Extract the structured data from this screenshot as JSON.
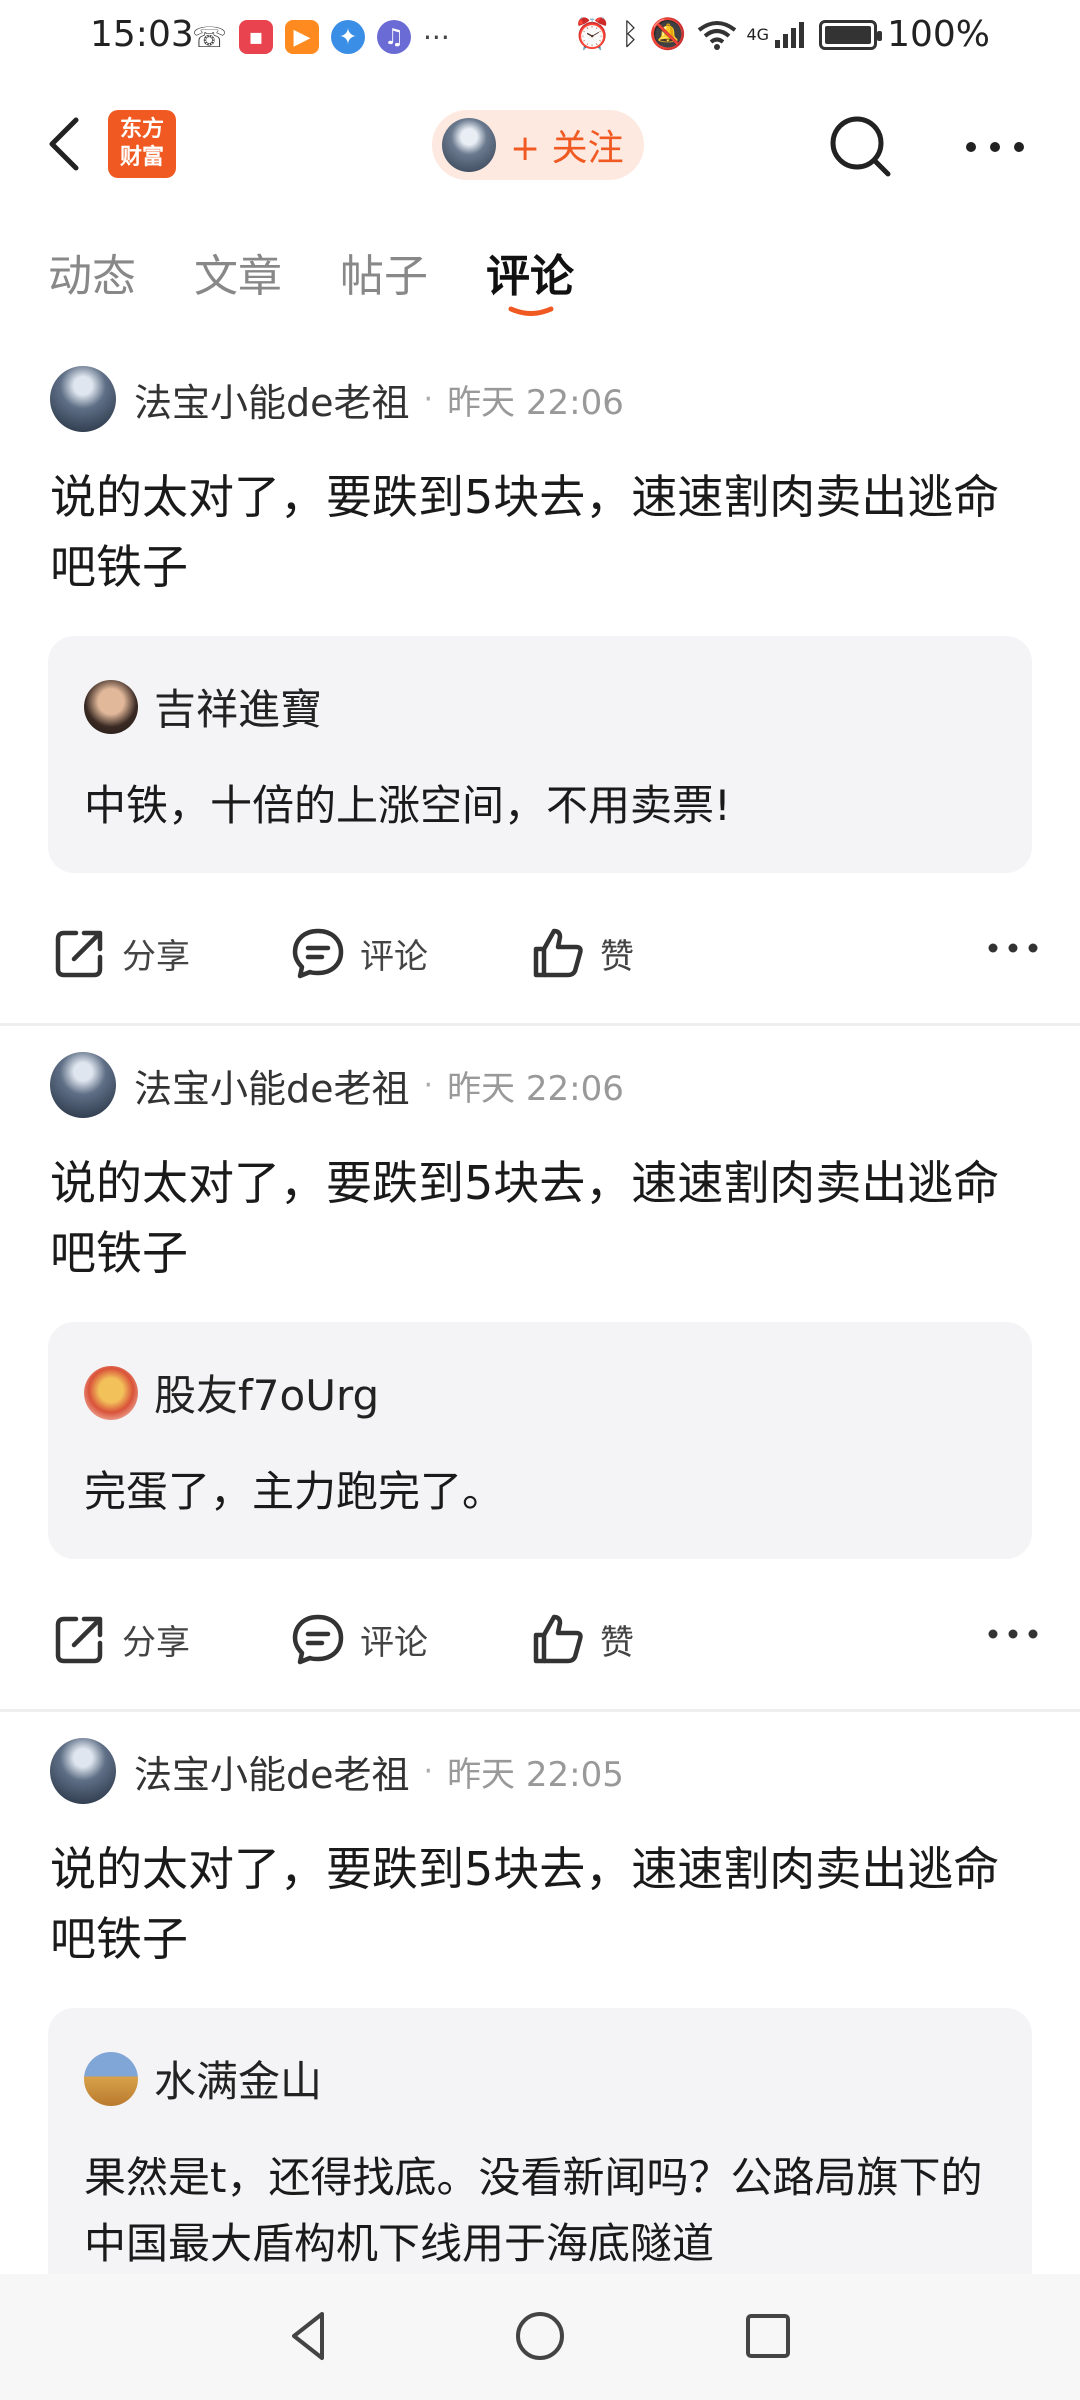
{
  "status_bar": {
    "time": "15:03",
    "battery": "100%",
    "network": "4G",
    "icons": [
      "missed-call-icon",
      "app-notification-icon",
      "video-app-icon",
      "browser-icon",
      "music-icon",
      "more-notifications-icon",
      "alarm-icon",
      "bluetooth-icon",
      "mute-icon",
      "wifi-icon",
      "signal-icon",
      "battery-icon"
    ]
  },
  "header": {
    "brand": {
      "line1": "东方",
      "line2": "财富"
    },
    "follow_label": "+ 关注",
    "accent_color": "#f05a22"
  },
  "tabs": [
    {
      "label": "动态",
      "active": false
    },
    {
      "label": "文章",
      "active": false
    },
    {
      "label": "帖子",
      "active": false
    },
    {
      "label": "评论",
      "active": true
    }
  ],
  "posts": [
    {
      "author": "法宝小能de老祖",
      "separator": "·",
      "time": "昨天 22:06",
      "text": "说的太对了，要跌到5块去，速速割肉卖出逃命吧铁子",
      "quote": {
        "author": "吉祥進寶",
        "text": "中铁，十倍的上涨空间，不用卖票!"
      },
      "actions": {
        "share": "分享",
        "comment": "评论",
        "like": "赞"
      }
    },
    {
      "author": "法宝小能de老祖",
      "separator": "·",
      "time": "昨天 22:06",
      "text": "说的太对了，要跌到5块去，速速割肉卖出逃命吧铁子",
      "quote": {
        "author": "股友f7oUrg",
        "text": "完蛋了，主力跑完了。"
      },
      "actions": {
        "share": "分享",
        "comment": "评论",
        "like": "赞"
      }
    },
    {
      "author": "法宝小能de老祖",
      "separator": "·",
      "time": "昨天 22:05",
      "text": "说的太对了，要跌到5块去，速速割肉卖出逃命吧铁子",
      "quote": {
        "author": "水满金山",
        "text": "果然是t，还得找底。没看新闻吗？公路局旗下的中国最大盾构机下线用于海底隧道"
      }
    }
  ]
}
